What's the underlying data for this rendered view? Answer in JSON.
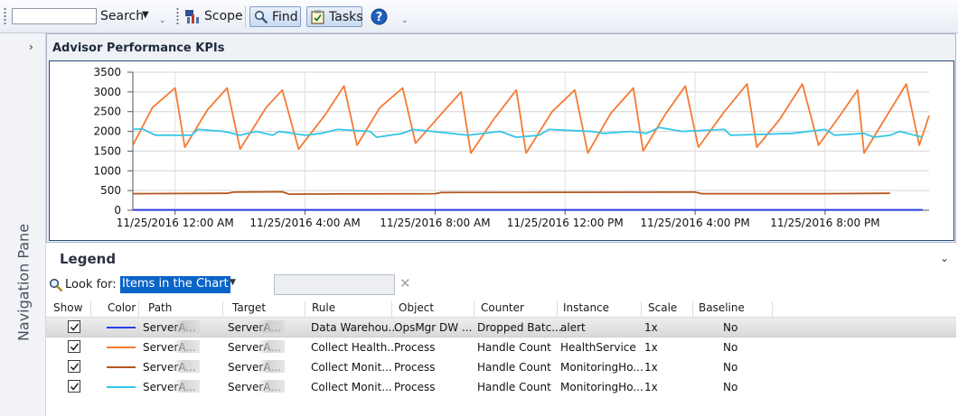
{
  "toolbar": {
    "search_label": "Search",
    "scope_label": "Scope",
    "find_label": "Find",
    "tasks_label": "Tasks",
    "search_value": ""
  },
  "navigation": {
    "label": "Navigation Pane"
  },
  "chart_panel": {
    "title": "Advisor Performance KPIs"
  },
  "chart_data": {
    "type": "line",
    "title": "",
    "xlabel": "",
    "ylabel": "",
    "ylim": [
      0,
      3500
    ],
    "y_ticks": [
      0,
      500,
      1000,
      1500,
      2000,
      2500,
      3000,
      3500
    ],
    "xlim_hours": [
      -1.3,
      23.2
    ],
    "x_tick_labels": [
      {
        "hour": 0,
        "label": "11/25/2016 12:00 AM"
      },
      {
        "hour": 4,
        "label": "11/25/2016 4:00 AM"
      },
      {
        "hour": 8,
        "label": "11/25/2016 8:00 AM"
      },
      {
        "hour": 12,
        "label": "11/25/2016 12:00 PM"
      },
      {
        "hour": 16,
        "label": "11/25/2016 4:00 PM"
      },
      {
        "hour": 20,
        "label": "11/25/2016 8:00 PM"
      }
    ],
    "grid": true,
    "series": [
      {
        "color": "#2a3ee6",
        "points": [
          [
            -1.3,
            10
          ],
          [
            23.0,
            10
          ]
        ]
      },
      {
        "color": "#f47b33",
        "points": [
          [
            -1.3,
            1650
          ],
          [
            -0.7,
            2600
          ],
          [
            0.0,
            3100
          ],
          [
            0.3,
            1600
          ],
          [
            1.0,
            2550
          ],
          [
            1.6,
            3100
          ],
          [
            2.0,
            1550
          ],
          [
            2.8,
            2600
          ],
          [
            3.3,
            3050
          ],
          [
            3.8,
            1550
          ],
          [
            4.6,
            2400
          ],
          [
            5.2,
            3150
          ],
          [
            5.6,
            1650
          ],
          [
            6.3,
            2600
          ],
          [
            7.0,
            3100
          ],
          [
            7.4,
            1700
          ],
          [
            8.2,
            2450
          ],
          [
            8.8,
            3000
          ],
          [
            9.1,
            1450
          ],
          [
            9.8,
            2300
          ],
          [
            10.5,
            3050
          ],
          [
            10.8,
            1450
          ],
          [
            11.6,
            2500
          ],
          [
            12.3,
            3050
          ],
          [
            12.7,
            1450
          ],
          [
            13.4,
            2450
          ],
          [
            14.1,
            3100
          ],
          [
            14.4,
            1500
          ],
          [
            15.1,
            2450
          ],
          [
            15.7,
            3150
          ],
          [
            16.1,
            1600
          ],
          [
            16.9,
            2500
          ],
          [
            17.6,
            3200
          ],
          [
            17.9,
            1600
          ],
          [
            18.6,
            2300
          ],
          [
            19.3,
            3200
          ],
          [
            19.8,
            1650
          ],
          [
            20.5,
            2450
          ],
          [
            21.0,
            3050
          ],
          [
            21.2,
            1450
          ],
          [
            21.9,
            2400
          ],
          [
            22.5,
            3200
          ],
          [
            22.9,
            1650
          ],
          [
            23.2,
            2400
          ]
        ]
      },
      {
        "color": "#b5571f",
        "points": [
          [
            -1.3,
            420
          ],
          [
            1.6,
            430
          ],
          [
            1.8,
            460
          ],
          [
            3.3,
            470
          ],
          [
            3.5,
            410
          ],
          [
            8.0,
            420
          ],
          [
            8.2,
            450
          ],
          [
            16.0,
            460
          ],
          [
            16.2,
            420
          ],
          [
            20.0,
            420
          ],
          [
            22.0,
            430
          ]
        ]
      },
      {
        "color": "#33c6e6",
        "points": [
          [
            -1.3,
            2050
          ],
          [
            -1.0,
            2060
          ],
          [
            -0.6,
            1900
          ],
          [
            0.5,
            1900
          ],
          [
            0.7,
            2050
          ],
          [
            1.5,
            2000
          ],
          [
            2.0,
            1900
          ],
          [
            2.5,
            2000
          ],
          [
            3.0,
            1900
          ],
          [
            3.2,
            2000
          ],
          [
            4.0,
            1900
          ],
          [
            4.5,
            1950
          ],
          [
            5.0,
            2050
          ],
          [
            6.0,
            2000
          ],
          [
            6.2,
            1850
          ],
          [
            7.0,
            1950
          ],
          [
            7.3,
            2050
          ],
          [
            8.5,
            1950
          ],
          [
            9.0,
            1900
          ],
          [
            10.0,
            2000
          ],
          [
            10.5,
            1850
          ],
          [
            11.2,
            1900
          ],
          [
            11.5,
            2050
          ],
          [
            12.8,
            2000
          ],
          [
            13.2,
            1950
          ],
          [
            14.0,
            2000
          ],
          [
            14.5,
            1950
          ],
          [
            14.9,
            2100
          ],
          [
            15.6,
            2000
          ],
          [
            16.9,
            2050
          ],
          [
            17.1,
            1900
          ],
          [
            19.0,
            1950
          ],
          [
            20.0,
            2050
          ],
          [
            20.3,
            1900
          ],
          [
            21.2,
            1950
          ],
          [
            21.5,
            1850
          ],
          [
            22.0,
            1900
          ],
          [
            22.3,
            2000
          ],
          [
            23.0,
            1850
          ]
        ]
      }
    ]
  },
  "legend": {
    "title": "Legend",
    "look_for_label": "Look for:",
    "look_for_value": "Items in the Chart",
    "columns": [
      "Show",
      "Color",
      "Path",
      "Target",
      "Rule",
      "Object",
      "Counter",
      "Instance",
      "Scale",
      "Baseline"
    ],
    "rows": [
      {
        "show": true,
        "color": "#2a3ee6",
        "path": "ServerA...",
        "target": "ServerA...",
        "rule": "Data Warehou...",
        "object": "OpsMgr DW ...",
        "counter": "Dropped Batc...",
        "instance": "alert",
        "scale": "1x",
        "baseline": "No",
        "selected": true
      },
      {
        "show": true,
        "color": "#f47b33",
        "path": "ServerA...",
        "target": "ServerA...",
        "rule": "Collect Health...",
        "object": "Process",
        "counter": "Handle Count",
        "instance": "HealthService",
        "scale": "1x",
        "baseline": "No",
        "selected": false
      },
      {
        "show": true,
        "color": "#b5571f",
        "path": "ServerA...",
        "target": "ServerA...",
        "rule": "Collect Monit...",
        "object": "Process",
        "counter": "Handle Count",
        "instance": "MonitoringHo...",
        "scale": "1x",
        "baseline": "No",
        "selected": false
      },
      {
        "show": true,
        "color": "#33c6e6",
        "path": "ServerA...",
        "target": "ServerA...",
        "rule": "Collect Monit...",
        "object": "Process",
        "counter": "Handle Count",
        "instance": "MonitoringHo...",
        "scale": "1x",
        "baseline": "No",
        "selected": false
      }
    ]
  }
}
